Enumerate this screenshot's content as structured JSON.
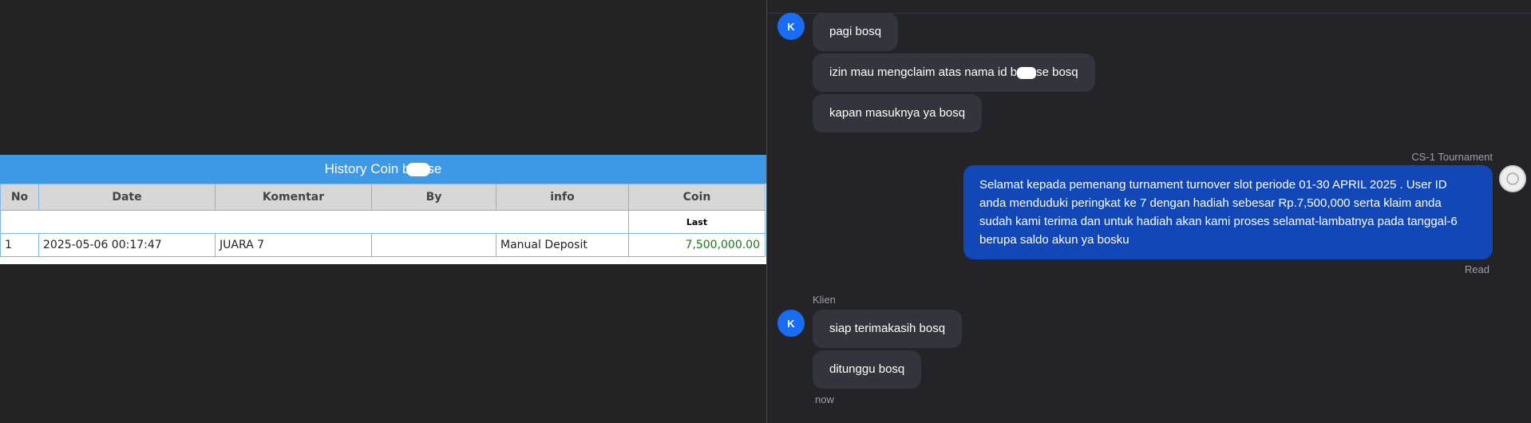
{
  "history": {
    "title_left": "History Coin b",
    "title_right": "se",
    "columns": [
      "No",
      "Date",
      "Komentar",
      "By",
      "info",
      "Coin"
    ],
    "sub_label": "Last",
    "rows": [
      {
        "no": "1",
        "date": "2025-05-06 00:17:47",
        "komentar": "JUARA 7",
        "by": "",
        "info": "Manual Deposit",
        "coin": "7,500,000.00"
      }
    ]
  },
  "chat": {
    "client_avatar_letter": "K",
    "messages_in_1": [
      "pagi bosq",
      "izin mau mengclaim atas nama id b",
      "se bosq",
      "kapan masuknya ya bosq"
    ],
    "agent_name": "CS-1 Tournament",
    "agent_message": "Selamat kepada pemenang turnament turnover slot periode 01-30 APRIL 2025 . User ID anda menduduki peringkat ke 7 dengan hadiah sebesar Rp.7,500,000 serta klaim anda sudah kami terima dan untuk hadiah akan kami proses selamat-lambatnya pada tanggal-6 berupa saldo akun ya bosku",
    "read_status": "Read",
    "client_name": "Klien",
    "messages_in_2": [
      "siap terimakasih bosq",
      "ditunggu bosq"
    ],
    "time_label": "now"
  },
  "colors": {
    "title_bar": "#3d98e6",
    "outgoing_bubble": "#1247b7",
    "incoming_bubble": "#34343c",
    "avatar": "#1a6cf2",
    "coin_text": "#1c7a1c"
  }
}
